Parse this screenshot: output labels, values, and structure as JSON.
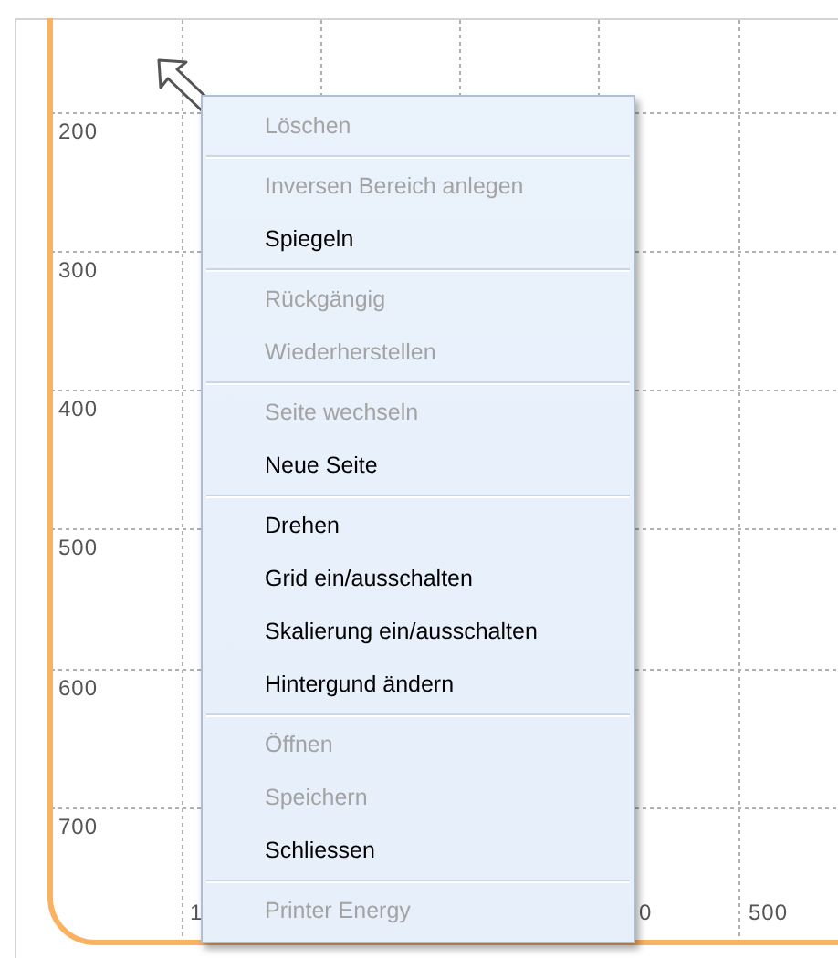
{
  "canvas": {
    "y_axis_labels": [
      "200",
      "300",
      "400",
      "500",
      "600",
      "700"
    ],
    "x_axis_labels": [
      "1",
      "0",
      "500"
    ]
  },
  "context_menu": {
    "groups": [
      [
        {
          "label": "Löschen",
          "disabled": true
        }
      ],
      [
        {
          "label": "Inversen Bereich anlegen",
          "disabled": true
        },
        {
          "label": "Spiegeln",
          "disabled": false
        }
      ],
      [
        {
          "label": "Rückgängig",
          "disabled": true
        },
        {
          "label": "Wiederherstellen",
          "disabled": true
        }
      ],
      [
        {
          "label": "Seite wechseln",
          "disabled": true
        },
        {
          "label": "Neue Seite",
          "disabled": false
        }
      ],
      [
        {
          "label": "Drehen",
          "disabled": false
        },
        {
          "label": "Grid ein/ausschalten",
          "disabled": false
        },
        {
          "label": "Skalierung ein/ausschalten",
          "disabled": false
        },
        {
          "label": "Hintergund ändern",
          "disabled": false
        }
      ],
      [
        {
          "label": "Öffnen",
          "disabled": true
        },
        {
          "label": "Speichern",
          "disabled": true
        },
        {
          "label": "Schliessen",
          "disabled": false
        }
      ],
      [
        {
          "label": "Printer Energy",
          "disabled": true
        }
      ]
    ]
  }
}
